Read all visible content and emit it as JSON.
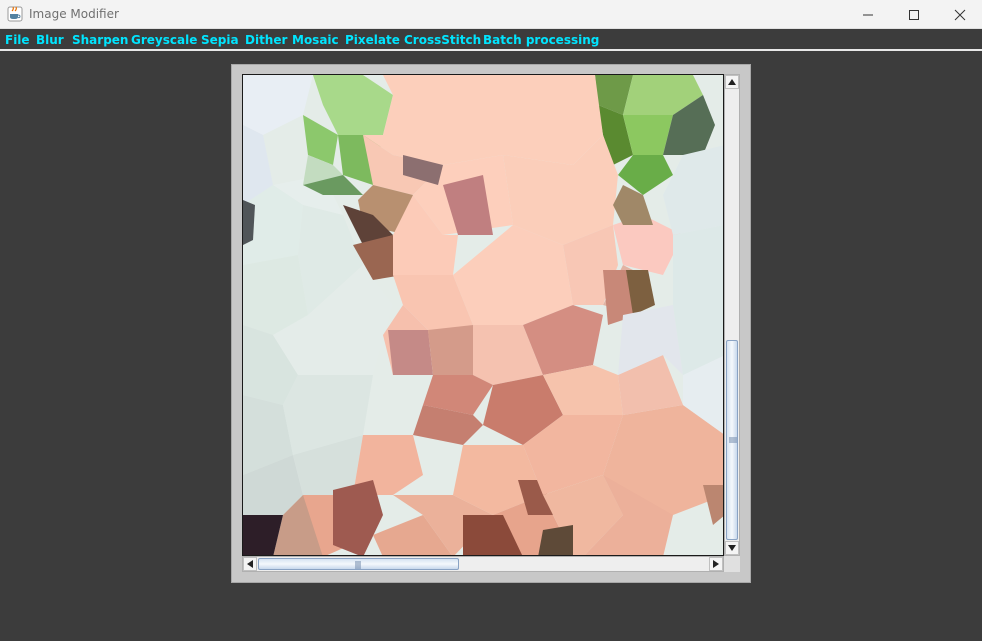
{
  "window": {
    "title": "Image Modifier",
    "icon": "java-coffee-icon",
    "controls": [
      "minimize-icon",
      "maximize-icon",
      "close-icon"
    ]
  },
  "menu": {
    "items": [
      "File",
      "Blur",
      "Sharpen",
      "Greyscale",
      "Sepia",
      "Dither",
      "Mosaic",
      "Pixelate",
      "CrossStitch",
      "Batch processing"
    ],
    "color": "#00e5ff"
  },
  "image_panel": {
    "image": "mosaic-processed-image",
    "vertical_scroll_position": 0.55,
    "horizontal_scroll_position": 0.0
  },
  "colors": {
    "background": "#3c3c3c",
    "frame": "#c8c8c8",
    "titlebar": "#f3f3f3"
  }
}
